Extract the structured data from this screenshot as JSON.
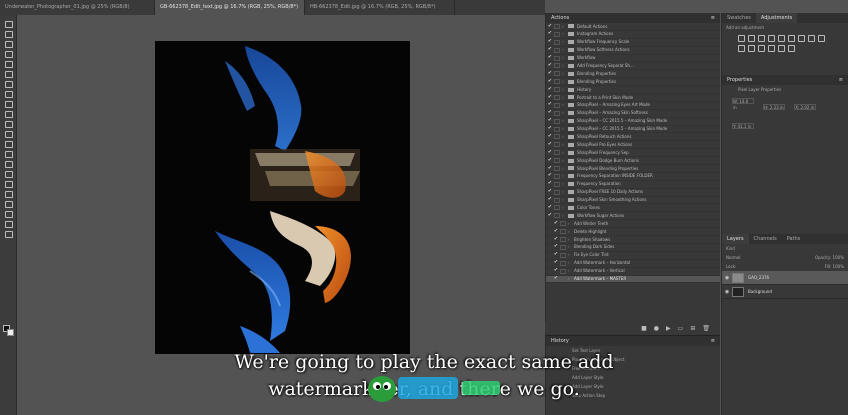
{
  "doc_tabs": [
    "Underwater_Photographer_01.jpg @ 25% (RGB/8)",
    "GB-662378_Edit_text.jpg @ 16.7% (RGB, 25%, RGB/8*)",
    "HB-662378_Edit.jpg @ 16.7% (RGB, 25%, RGB/8*)"
  ],
  "actions_panel": {
    "title": "Actions",
    "rows": [
      {
        "check": "✔",
        "type": "folder",
        "label": "Default Actions"
      },
      {
        "check": "✔",
        "type": "folder",
        "label": "Instagram Actions"
      },
      {
        "check": "✔",
        "type": "folder",
        "label": "Workflow Frequency Scale"
      },
      {
        "check": "✔",
        "type": "folder",
        "label": "Workflow Softness Actions"
      },
      {
        "check": "✔",
        "type": "folder",
        "label": "Workflow"
      },
      {
        "check": "✔",
        "type": "folder",
        "label": "Add Frequency Separat Sh..."
      },
      {
        "check": "✔",
        "type": "folder",
        "label": "Blending Properties"
      },
      {
        "check": "✔",
        "type": "folder",
        "label": "Blending Properties"
      },
      {
        "check": "✔",
        "type": "folder",
        "label": "History"
      },
      {
        "check": "✔",
        "type": "folder",
        "label": "Portrait to a Print Skin Mode"
      },
      {
        "check": "✔",
        "type": "folder",
        "label": "SharpPixel – Amazing Eyes Art Mode"
      },
      {
        "check": "✔",
        "type": "folder",
        "label": "SharpPixel – Amazing Skin Softness"
      },
      {
        "check": "✔",
        "type": "folder",
        "label": "SharpPixel – CC 2015.5 – Amazing Skin Mode"
      },
      {
        "check": "✔",
        "type": "folder",
        "label": "SharpPixel – CC 2015.5 – Amazing Skin Mode"
      },
      {
        "check": "✔",
        "type": "folder",
        "label": "SharpPixel Retouch Actions"
      },
      {
        "check": "✔",
        "type": "folder",
        "label": "SharpPixel Pro Eyes Actions"
      },
      {
        "check": "✔",
        "type": "folder",
        "label": "SharpPixel Frequency Sep"
      },
      {
        "check": "✔",
        "type": "folder",
        "label": "SharpPixel Dodge Burn Actions"
      },
      {
        "check": "✔",
        "type": "folder",
        "label": "SharpPixel Blending Properties"
      },
      {
        "check": "✔",
        "type": "folder",
        "label": "Frequency Separation INSIDE FOLDER"
      },
      {
        "check": "✔",
        "type": "folder",
        "label": "Frequency Separation"
      },
      {
        "check": "✔",
        "type": "folder",
        "label": "SharpPixel FREE 10 Daily Actions"
      },
      {
        "check": "✔",
        "type": "folder",
        "label": "SharpPixel Skin Smoothing Actions"
      },
      {
        "check": "✔",
        "type": "folder",
        "label": "Color Tones"
      },
      {
        "check": "✔",
        "type": "folder",
        "label": "Workflow Sugar Actions"
      },
      {
        "check": "✔",
        "type": "sub",
        "label": "Add Winter Teeth"
      },
      {
        "check": "✔",
        "type": "sub",
        "label": "Delete Highlight"
      },
      {
        "check": "✔",
        "type": "sub",
        "label": "Brighten Shadows"
      },
      {
        "check": "✔",
        "type": "sub",
        "label": "Blending Dark Sides"
      },
      {
        "check": "✔",
        "type": "sub",
        "label": "Fix Eye Color Tint"
      },
      {
        "check": "✔",
        "type": "sub",
        "label": "Add Watermark – Horizontal"
      },
      {
        "check": "✔",
        "type": "sub",
        "label": "Add Watermark – Vertical"
      },
      {
        "check": "✔",
        "type": "sub",
        "label": "Add Watermark – MASTER"
      }
    ],
    "footer_icons": [
      "stop-icon",
      "record-icon",
      "play-icon",
      "folder-icon",
      "new-action-icon",
      "trash-icon"
    ]
  },
  "history_panel": {
    "title": "History",
    "rows": [
      "Set Text Layer",
      "Place Linked Smart Object",
      "Free Transform",
      "Add Layer Style",
      "Add Layer Style",
      "Stop Action Step"
    ]
  },
  "right_col": {
    "tabs": [
      "Swatches",
      "Adjustments"
    ],
    "adjustments_label": "Add an adjustment",
    "properties_title": "Properties",
    "properties_label": "Pixel Layer Properties",
    "prop_fields": [
      "W: 14.6 in",
      "H: 2.33 in",
      "X: 2.02 in",
      "Y: 41.1 in"
    ],
    "layers_tabs": [
      "Layers",
      "Channels",
      "Paths"
    ],
    "layers_kind": "Kind",
    "layers_mode": "Normal",
    "layers_opacity": "Opacity: 100%",
    "layers_lock": "Lock:",
    "layers_fill": "Fill: 100%",
    "layers": [
      {
        "name": "GAO_2376",
        "selected": true,
        "thumb": "light"
      },
      {
        "name": "Background",
        "selected": false,
        "thumb": "dark"
      }
    ]
  },
  "subtitles": {
    "line1": "We're going to play the exact same add",
    "line2": "watermark       ter, and there we go."
  }
}
